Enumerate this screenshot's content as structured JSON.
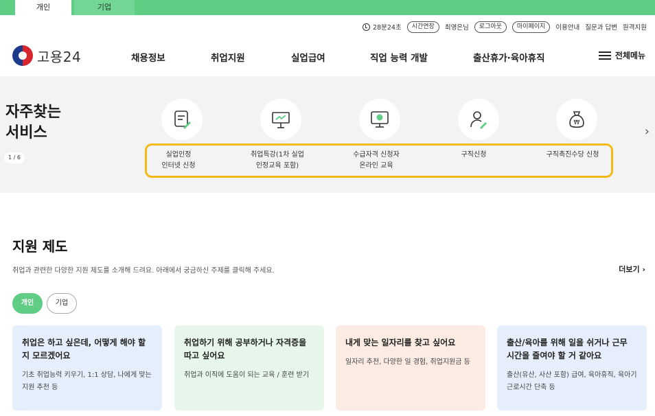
{
  "top_tabs": {
    "personal": "개인",
    "company": "기업"
  },
  "utility": {
    "timer": "28분24초",
    "extend": "시간연장",
    "user": "최영은님",
    "logout": "로그아웃",
    "mypage": "마이페이지",
    "guide": "이용안내",
    "qna": "질문과 답변",
    "remote": "원격지원"
  },
  "logo": {
    "text": "고용24"
  },
  "gnb": [
    "채용정보",
    "취업지원",
    "실업급여",
    "직업 능력 개발",
    "출산휴가·육아휴직"
  ],
  "allmenu": "전체메뉴",
  "quick": {
    "title_line1": "자주찾는",
    "title_line2": "서비스",
    "pager": "1 / 6",
    "items": [
      {
        "line1": "실업인정",
        "line2": "인터넷 신청",
        "icon": "document-pen-icon"
      },
      {
        "line1": "취업특강(1차 실업",
        "line2": "인정교육 포함)",
        "icon": "presentation-board-icon"
      },
      {
        "line1": "수급자격 신청자",
        "line2": "온라인 교육",
        "icon": "monitor-play-icon"
      },
      {
        "line1": "구직신청",
        "line2": "",
        "icon": "person-pen-icon"
      },
      {
        "line1": "구직촉진수당 신청",
        "line2": "",
        "icon": "money-bag-icon"
      }
    ],
    "highlight_color": "#f4b915"
  },
  "support": {
    "title": "지원 제도",
    "desc": "취업과 관련한 다양한 지원 제도를 소개해 드려요. 아래에서 궁금하신 주제를 클릭해 주세요.",
    "more": "더보기 ›",
    "toggle_on": "개인",
    "toggle_off": "기업",
    "cards": [
      {
        "title": "취업은 하고 싶은데, 어떻게 해야 할 지 모르겠어요",
        "desc": "기초 취업능력 키우기, 1:1 상담, 나에게 맞는 지원 추천 등",
        "bg": "#e4effb"
      },
      {
        "title": "취업하기 위해 공부하거나 자격증을 따고 싶어요",
        "desc": "취업과 이직에 도움이 되는 교육 / 훈련 받기",
        "bg": "#e6f6ea"
      },
      {
        "title": "내게 맞는 일자리를 찾고 싶어요",
        "desc": "일자리 추천, 다양한 일 경험, 취업지원금 등",
        "bg": "#fcebe3"
      },
      {
        "title": "출산/육아를 위해 일을 쉬거나 근무 시간을 줄여야 할 거 같아요",
        "desc": "출산(유산, 사산 포함) 급여, 육아휴직, 육아기 근로시간 단축 등",
        "bg": "#e6eefb"
      }
    ]
  },
  "colors": {
    "brand_green": "#5fcd84",
    "panel_gray": "#f3f3f3"
  }
}
